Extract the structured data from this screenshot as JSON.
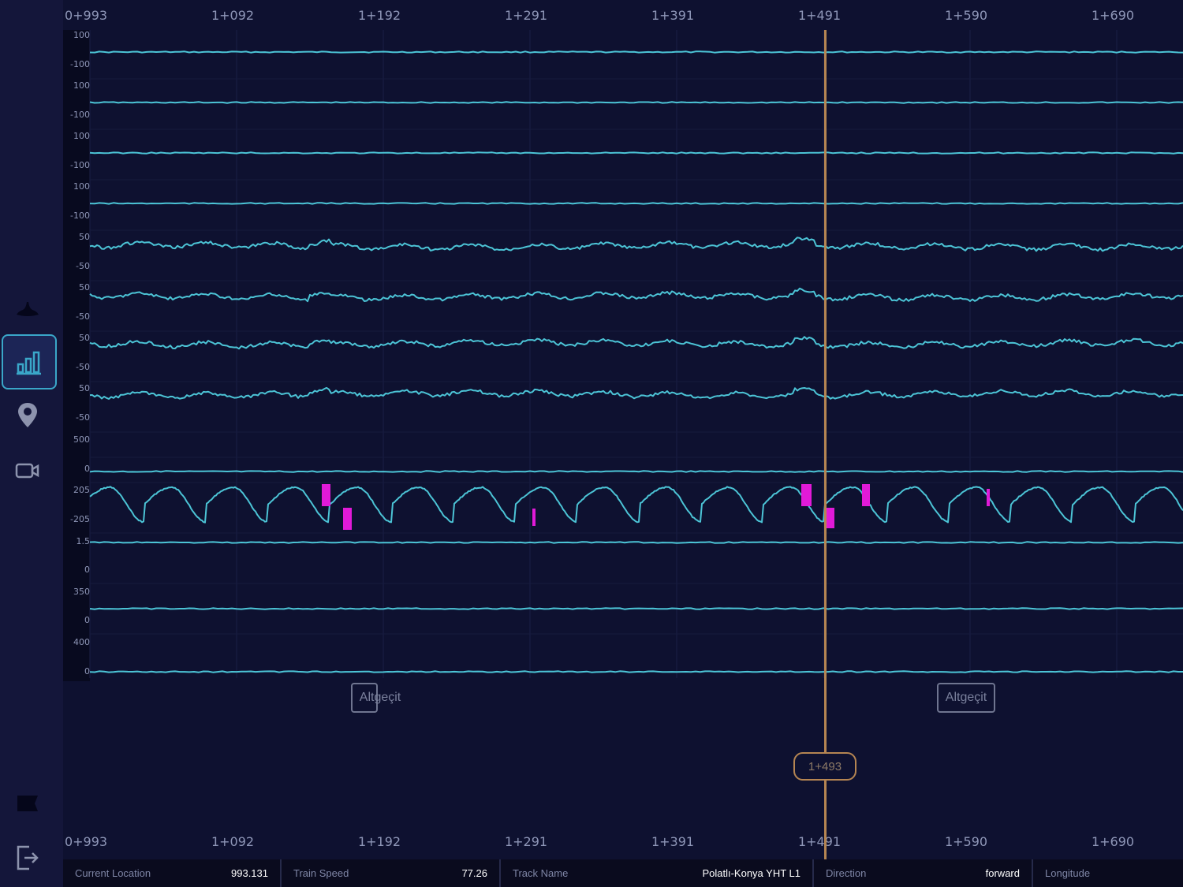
{
  "colors": {
    "background": "#0b0d2a",
    "plot": "#0e1130",
    "trace": "#4cc4d6",
    "highlight": "#e11ad8",
    "cursor": "#b58552"
  },
  "sidebar": {
    "items": [
      {
        "icon": "hump-icon"
      },
      {
        "icon": "bar-chart-icon",
        "active": true
      },
      {
        "icon": "location-pin-icon"
      },
      {
        "icon": "video-camera-icon"
      },
      {
        "icon": "flag-icon"
      },
      {
        "icon": "logout-icon"
      }
    ]
  },
  "axis": {
    "km_labels": [
      "0+993",
      "1+092",
      "1+192",
      "1+291",
      "1+391",
      "1+491",
      "1+590",
      "1+690"
    ]
  },
  "chart_data": {
    "type": "line",
    "x_range_m": [
      993,
      1690
    ],
    "channels": [
      {
        "y_top": "100",
        "y_bottom": "-100",
        "shape": "flat",
        "value": 0
      },
      {
        "y_top": "100",
        "y_bottom": "-100",
        "shape": "flat",
        "value": 0
      },
      {
        "y_top": "100",
        "y_bottom": "-100",
        "shape": "flat",
        "value": 0
      },
      {
        "y_top": "100",
        "y_bottom": "-100",
        "shape": "flat",
        "value": 0
      },
      {
        "y_top": "50",
        "y_bottom": "-50",
        "shape": "noisy"
      },
      {
        "y_top": "50",
        "y_bottom": "-50",
        "shape": "noisy"
      },
      {
        "y_top": "50",
        "y_bottom": "-50",
        "shape": "noisy"
      },
      {
        "y_top": "50",
        "y_bottom": "-50",
        "shape": "noisy"
      },
      {
        "y_top": "500",
        "y_bottom": "0",
        "shape": "flat"
      },
      {
        "y_top": "205",
        "y_bottom": "-205",
        "shape": "oscillating"
      },
      {
        "y_top": "1.5",
        "y_bottom": "0",
        "shape": "flat"
      },
      {
        "y_top": "350",
        "y_bottom": "0",
        "shape": "flat"
      },
      {
        "y_top": "400",
        "y_bottom": "0",
        "shape": "flat"
      }
    ]
  },
  "markers": [
    {
      "label": "Altgeçit"
    },
    {
      "label": "Altgeçit"
    }
  ],
  "cursor": {
    "label": "1+493"
  },
  "status": {
    "current_location_label": "Current Location",
    "current_location_value": "993.131",
    "train_speed_label": "Train Speed",
    "train_speed_value": "77.26",
    "track_name_label": "Track Name",
    "track_name_value": "Polatlı-Konya YHT L1",
    "direction_label": "Direction",
    "direction_value": "forward",
    "longitude_label": "Longitude"
  }
}
